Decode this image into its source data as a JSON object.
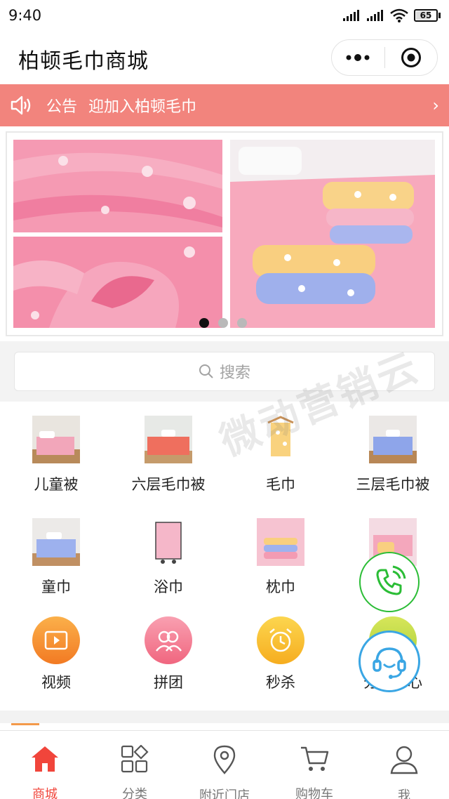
{
  "status": {
    "time": "9:40",
    "battery": "65"
  },
  "header": {
    "title": "柏顿毛巾商城"
  },
  "notice": {
    "label": "公告",
    "text": "迎加入柏顿毛巾"
  },
  "search": {
    "placeholder": "搜索"
  },
  "categories": [
    {
      "label": "儿童被",
      "icon": "bed-pink-photo"
    },
    {
      "label": "六层毛巾被",
      "icon": "bed-coral-photo"
    },
    {
      "label": "毛巾",
      "icon": "towel-hanger-photo"
    },
    {
      "label": "三层毛巾被",
      "icon": "bed-blue-photo"
    },
    {
      "label": "童巾",
      "icon": "bed-blue-photo"
    },
    {
      "label": "浴巾",
      "icon": "towel-rack-photo"
    },
    {
      "label": "枕巾",
      "icon": "folded-towels-photo"
    },
    {
      "label": "",
      "icon": "bed-photo"
    }
  ],
  "features": [
    {
      "label": "视频",
      "icon": "video-icon"
    },
    {
      "label": "拼团",
      "icon": "group-icon"
    },
    {
      "label": "秒杀",
      "icon": "alarm-icon"
    },
    {
      "label": "分销中心",
      "icon": "distribution-icon"
    }
  ],
  "watermark": "微动营销云",
  "tabs": [
    {
      "label": "商城",
      "icon": "home-icon",
      "active": true
    },
    {
      "label": "分类",
      "icon": "category-icon"
    },
    {
      "label": "附近门店",
      "icon": "location-icon"
    },
    {
      "label": "购物车",
      "icon": "cart-icon"
    },
    {
      "label": "我",
      "icon": "user-icon"
    }
  ],
  "colors": {
    "notice_bg": "#f2847d",
    "accent": "#f1453b",
    "call": "#2bbd36",
    "service": "#3aa6e4",
    "video": "#f7922f",
    "group": "#f47c8e",
    "alarm": "#f9c12e"
  }
}
